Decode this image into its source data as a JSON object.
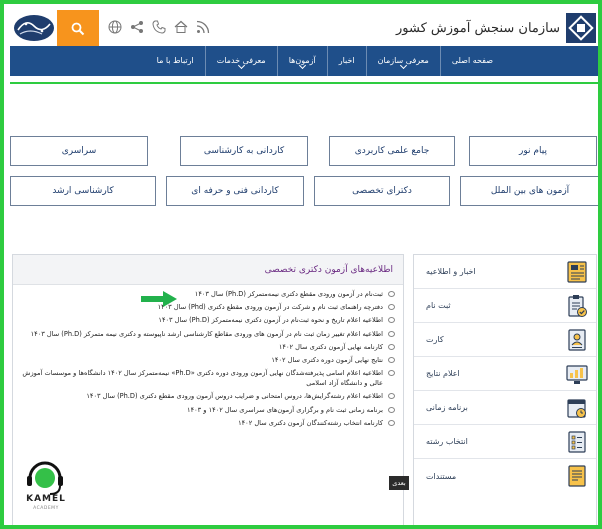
{
  "header": {
    "brand_text": "سازمان سنجش آموزش کشور",
    "icons": [
      "rss-icon",
      "home-icon",
      "phone-icon",
      "sitemap-icon",
      "globe-icon"
    ]
  },
  "nav": {
    "items": [
      {
        "label": "صفحه اصلی",
        "has_sub": false
      },
      {
        "label": "معرفی سازمان",
        "has_sub": true
      },
      {
        "label": "اخبار",
        "has_sub": false
      },
      {
        "label": "آزمون‌ها",
        "has_sub": true
      },
      {
        "label": "معرفی خدمات",
        "has_sub": true
      },
      {
        "label": "ارتباط با ما",
        "has_sub": false
      }
    ]
  },
  "exams": {
    "row1": [
      "پیام نور",
      "جامع علمی کاربردی",
      "کاردانی به کارشناسی",
      "سراسری"
    ],
    "row2": [
      "آزمون های بین الملل",
      "دکترای تخصصی",
      "کاردانی فنی و حرفه ای",
      "کارشناسی ارشد"
    ]
  },
  "sidebar": {
    "items": [
      {
        "label": "اخبار و اطلاعیه"
      },
      {
        "label": "ثبت نام"
      },
      {
        "label": "کارت"
      },
      {
        "label": "اعلام نتایج"
      },
      {
        "label": "برنامه زمانی"
      },
      {
        "label": "انتخاب رشته"
      },
      {
        "label": "مستندات"
      }
    ]
  },
  "panel": {
    "title": "اطلاعیه‌های آزمون دکتری تخصصی",
    "items": [
      "ثبت‌نام در آزمون ورودی مقطع دکتری نیمه‌متمرکز (Ph.D) سال ۱۴۰۳",
      "دفترچه راهنمای ثبت نام و شرکت در آزمون ورودی مقطع دکتری (Phd) سال ۱۴۰۳",
      "اطلاعیه اعلام تاریخ و نحوه ثبت‌نام در آزمون دکتری نیمه‌متمرکز (Ph.D) سال ۱۴۰۳",
      "اطلاعیه اعلام تغییر زمان ثبت نام در آزمون های ورودی مقاطع کارشناسی ارشد ناپیوسته و دکتری نیمه متمرکز (Ph.D) سال ۱۴۰۳",
      "کارنامه نهایی آزمون دکتری سال ۱۴۰۲",
      "نتایج نهایی آزمون دوره دکتری سال ۱۴۰۲",
      "اطلاعیه اعلام اسامی پذیرفته‌شدگان نهایی آزمون ورودی دوره دکتری «Ph.D» نیمه‌متمرکز سال ۱۴۰۲ دانشگاه‌ها و موسسات آموزش عالی و دانشگاه آزاد اسلامی",
      "اطلاعیه اعلام رشته‌گرایش‌ها، دروس امتحانی و ضرایب دروس آزمون ورودی مقطع دکتری (Ph.D) سال ۱۴۰۳",
      "برنامه زمانی ثبت نام و برگزاری آزمون‌های سراسری سال ۱۴۰۲ و ۱۴۰۳",
      "کارنامه انتخاب رشته‌کنندگان آزمون دکتری سال ۱۴۰۲"
    ],
    "next_label": "بعدی"
  },
  "watermark": {
    "brand": "KAMEL",
    "sub": "ACADEMY"
  },
  "colors": {
    "frame": "#2ecc40",
    "nav": "#1f4f8a",
    "search": "#f7941d",
    "title": "#6a2a82"
  }
}
